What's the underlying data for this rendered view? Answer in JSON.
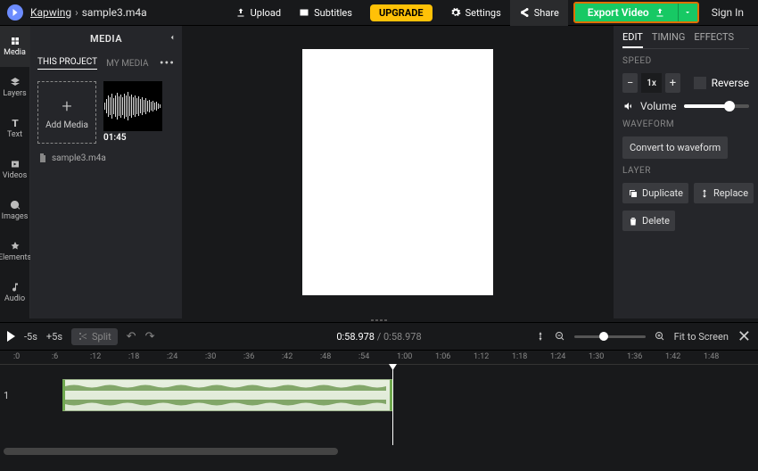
{
  "breadcrumb": {
    "app": "Kapwing",
    "sep": "›",
    "file": "sample3.m4a"
  },
  "top": {
    "upload": "Upload",
    "subtitles": "Subtitles",
    "upgrade": "UPGRADE",
    "settings": "Settings",
    "share": "Share",
    "export": "Export Video",
    "signin": "Sign In"
  },
  "rail": {
    "media": "Media",
    "layers": "Layers",
    "text": "Text",
    "videos": "Videos",
    "images": "Images",
    "elements": "Elements",
    "audio": "Audio"
  },
  "media": {
    "title": "MEDIA",
    "tab_project": "THIS PROJECT",
    "tab_my": "MY MEDIA",
    "add": "Add Media",
    "clip_duration": "01:45",
    "clip_name": "sample3.m4a"
  },
  "right": {
    "tab_edit": "EDIT",
    "tab_timing": "TIMING",
    "tab_effects": "EFFECTS",
    "label_speed": "SPEED",
    "speed_value": "1x",
    "reverse": "Reverse",
    "volume": "Volume",
    "label_waveform": "WAVEFORM",
    "convert": "Convert to waveform",
    "label_layer": "LAYER",
    "duplicate": "Duplicate",
    "replace": "Replace",
    "delete": "Delete"
  },
  "playbar": {
    "back": "-5s",
    "fwd": "+5s",
    "split": "Split",
    "current": "0:58.978",
    "total": "0:58.978",
    "fit": "Fit to Screen"
  },
  "ruler": [
    ":0",
    ":6",
    ":12",
    ":18",
    ":24",
    ":30",
    ":36",
    ":42",
    ":48",
    ":54",
    "1:00",
    "1:06",
    "1:12",
    "1:18",
    "1:24",
    "1:30",
    "1:36",
    "1:42",
    "1:48"
  ],
  "track_number": "1"
}
